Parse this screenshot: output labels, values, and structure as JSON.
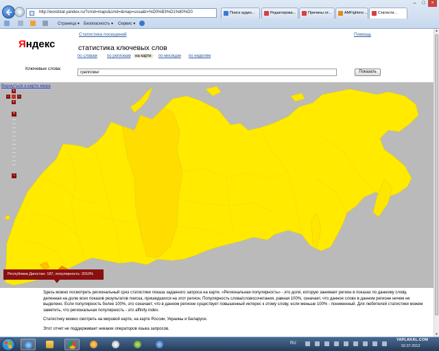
{
  "browser": {
    "address_url": "http://wordstat.yandex.ru/?cmd=maps&cmd=&map=ussa&t=%D0%B3%D1%80%D0",
    "tabs": [
      {
        "label": "Поиск аудио...",
        "color": "#3a7bd5"
      },
      {
        "label": "Редактирова...",
        "color": "#d94040"
      },
      {
        "label": "Причины от...",
        "color": "#d94040"
      },
      {
        "label": "AMFighters ...",
        "color": "#e08a1e"
      },
      {
        "label": "Статисти...",
        "color": "#d94040",
        "active": true
      }
    ],
    "command_bar": {
      "page": "Страница",
      "safety": "Безопасность",
      "tools": "Сервис"
    },
    "window_controls": {
      "minimize": "–",
      "maximize": "□",
      "close": "×"
    }
  },
  "header": {
    "logo_first": "Я",
    "logo_rest": "ндекс",
    "stat_link": "Статистика посещений",
    "help_link": "Помощь",
    "title": "статистика ключевых слов",
    "subtabs": [
      {
        "label": "по словам",
        "active": false
      },
      {
        "label": "по регионам",
        "active": false
      },
      {
        "label": "на карте",
        "active": true
      },
      {
        "label": "по месяцам",
        "active": false
      },
      {
        "label": "по неделям",
        "active": false
      }
    ]
  },
  "search": {
    "label": "Ключевые слова:",
    "value": "грепплинг",
    "button": "Показать"
  },
  "map": {
    "back_link": "Вернуться к карте мира",
    "pan": {
      "up": "˄",
      "left": "‹",
      "right": "›",
      "down": "˅",
      "center": "·"
    },
    "zoom_in": "+",
    "zoom_out": "−",
    "tooltip": "Республика Дагестан: 187, популярность: 2010%",
    "colors": {
      "background": "#bababa",
      "region_default": "#ffea00",
      "region_strong": "#ffdd00",
      "region_dagestan": "#f08a00",
      "tooltip": "#8a0f0f"
    }
  },
  "description": {
    "paragraphs": [
      "Здесь можно посмотреть региональный срез статистики показа заданного запроса на карте. «Региональная популярность» - это доля, которую занимает регион в показах по данному слову, деленная на долю всех показов результатов поиска, пришедшихся на этот регион. Популярность слова/словосочетания, равная 100%, означает, что данное слово в данном регионе ничем не выделено. Если популярность более 100%, это означает, что в данном регионе существует повышенный интерес к этому слову, если меньше 100% - пониженный. Для любителей статистики можем заметить, что региональная популярность - это affinity index.",
      "Статистику можно смотреть на мировой карте, на карте России, Украины и Беларуси.",
      "Этот отчет не поддерживает никаких операторов языка запросов."
    ]
  },
  "taskbar": {
    "lang": "RU",
    "watermark": "YAPLAKAL.COM",
    "date": "02.07.2012"
  }
}
